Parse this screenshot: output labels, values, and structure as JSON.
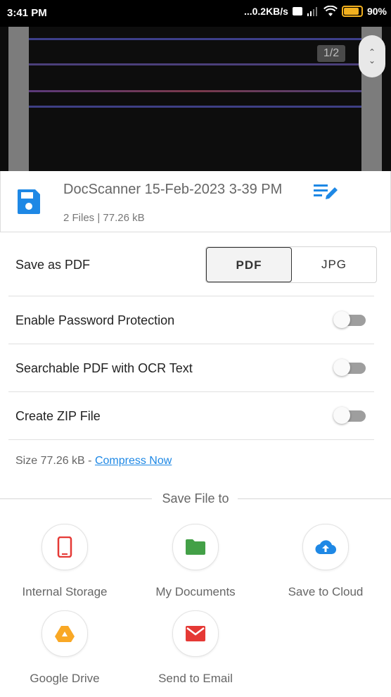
{
  "status_bar": {
    "time": "3:41 PM",
    "network_speed": "...0.2KB/s",
    "battery": "90%",
    "battery_level": 0.9
  },
  "preview": {
    "page_counter": "1/2"
  },
  "file": {
    "title": "DocScanner 15-Feb-2023 3-39 PM",
    "meta": "2 Files  |  77.26 kB"
  },
  "save_as": {
    "label": "Save as PDF",
    "options": [
      "PDF",
      "JPG"
    ],
    "selected": "PDF"
  },
  "settings": [
    {
      "label": "Enable Password Protection",
      "enabled": false
    },
    {
      "label": "Searchable PDF with OCR Text",
      "enabled": false
    },
    {
      "label": "Create ZIP File",
      "enabled": false
    }
  ],
  "size": {
    "prefix": "Size 77.26 kB - ",
    "compress_link": "Compress Now"
  },
  "save_file_to": {
    "heading": "Save File to",
    "destinations": [
      {
        "label": "Internal Storage",
        "icon": "phone-icon",
        "color": "#e53935"
      },
      {
        "label": "My Documents",
        "icon": "folder-icon",
        "color": "#43a047"
      },
      {
        "label": "Save to Cloud",
        "icon": "cloud-upload-icon",
        "color": "#1e88e5"
      },
      {
        "label": "Google Drive",
        "icon": "google-drive-icon",
        "color": "#f9a825"
      },
      {
        "label": "Send to Email",
        "icon": "email-icon",
        "color": "#e53935"
      }
    ]
  },
  "colors": {
    "accent": "#1e88e5",
    "link": "#1e88e5"
  }
}
